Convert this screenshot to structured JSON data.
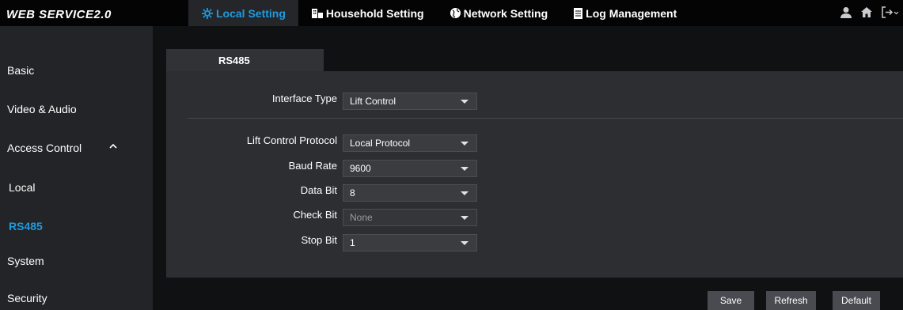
{
  "app": {
    "brand": "WEB SERVICE2.0"
  },
  "top_nav": {
    "tabs": [
      {
        "label": "Local Setting",
        "icon": "gear-icon",
        "active": true
      },
      {
        "label": "Household Setting",
        "icon": "building-icon",
        "active": false
      },
      {
        "label": "Network Setting",
        "icon": "globe-icon",
        "active": false
      },
      {
        "label": "Log Management",
        "icon": "document-icon",
        "active": false
      }
    ],
    "tools": [
      "user-icon",
      "home-icon",
      "logout-icon"
    ]
  },
  "sidebar": {
    "items": [
      {
        "label": "Basic"
      },
      {
        "label": "Video & Audio"
      },
      {
        "label": "Access Control",
        "expanded": true
      },
      {
        "label": "Local"
      },
      {
        "label": "RS485",
        "selected": true
      },
      {
        "label": "System"
      },
      {
        "label": "Security"
      }
    ]
  },
  "content": {
    "tab_label": "RS485",
    "fields": [
      {
        "label": "Interface Type",
        "value": "Lift Control",
        "disabled": false
      },
      {
        "label": "Lift Control Protocol",
        "value": "Local Protocol",
        "disabled": false
      },
      {
        "label": "Baud Rate",
        "value": "9600",
        "disabled": false
      },
      {
        "label": "Data Bit",
        "value": "8",
        "disabled": false
      },
      {
        "label": "Check Bit",
        "value": "None",
        "disabled": true
      },
      {
        "label": "Stop Bit",
        "value": "1",
        "disabled": false
      }
    ]
  },
  "buttons": {
    "save": "Save",
    "refresh": "Refresh",
    "default": "Default"
  },
  "colors": {
    "accent": "#1e9be0",
    "background": "#101113",
    "panel": "#2c2e31",
    "sidebar": "#222427"
  }
}
